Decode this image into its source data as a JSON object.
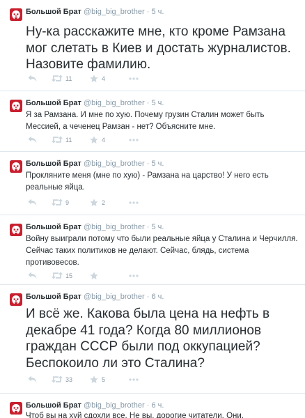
{
  "colors": {
    "avatar_red": "#c8202f",
    "text": "#292f33",
    "muted": "#8899a6",
    "action_icon": "#ccd6dd",
    "divider": "#e1e8ed"
  },
  "icons": {
    "avatar": "big-brother-logo-icon",
    "reply": "reply-icon",
    "retweet": "retweet-icon",
    "favorite": "star-icon",
    "more": "more-dots-icon"
  },
  "tweets": [
    {
      "name": "Большой Брат",
      "handle": "@big_big_brother",
      "separator": "·",
      "time": "5 ч.",
      "text": "Ну-ка расскажите мне, кто кроме Рамзана мог слетать в Киев и достать журналистов. Назовите фамилию.",
      "retweets": "11",
      "favorites": "4"
    },
    {
      "name": "Большой Брат",
      "handle": "@big_big_brother",
      "separator": "·",
      "time": "5 ч.",
      "text": "Я за Рамзана. И мне по хую. Почему грузин Сталин может быть Мессией, а чеченец Рамзан - нет? Объясните мне.",
      "retweets": "11",
      "favorites": "4"
    },
    {
      "name": "Большой Брат",
      "handle": "@big_big_brother",
      "separator": "·",
      "time": "5 ч.",
      "text": "Прокляните меня (мне по хую) - Рамзана на царство! У него есть реальные яйца.",
      "retweets": "9",
      "favorites": "2"
    },
    {
      "name": "Большой Брат",
      "handle": "@big_big_brother",
      "separator": "·",
      "time": "5 ч.",
      "text": "Войну выиграли потому что были реальные яйца у Сталина и Черчилля. Сейчас таких политиков не делают. Сейчас, блядь, система противовесов.",
      "retweets": "15",
      "favorites": ""
    },
    {
      "name": "Большой Брат",
      "handle": "@big_big_brother",
      "separator": "·",
      "time": "6 ч.",
      "text": "И всё же. Какова была цена на нефть в декабре 41 года? Когда 80 миллионов граждан СССР были под оккупацией? Беспокоило ли это Сталина?",
      "retweets": "33",
      "favorites": "5"
    },
    {
      "name": "Большой Брат",
      "handle": "@big_big_brother",
      "separator": "·",
      "time": "6 ч.",
      "text": "Чтоб вы на хуй сдохли все. Не вы, дорогие читатели. Они.",
      "retweets": "",
      "favorites": ""
    }
  ]
}
